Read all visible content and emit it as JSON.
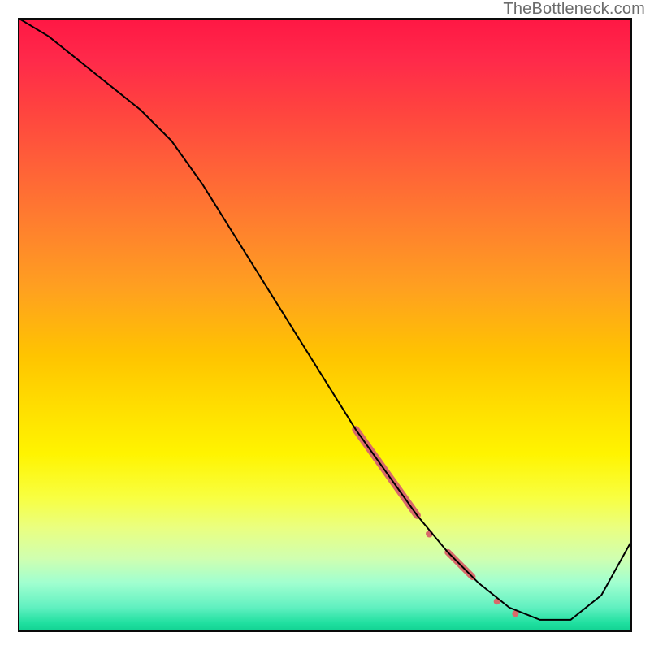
{
  "watermark": "TheBottleneck.com",
  "chart_data": {
    "type": "line",
    "title": "",
    "xlabel": "",
    "ylabel": "",
    "xlim": [
      0,
      100
    ],
    "ylim": [
      0,
      100
    ],
    "grid": false,
    "legend": false,
    "series": [
      {
        "name": "bottleneck-curve",
        "x": [
          0,
          5,
          10,
          15,
          20,
          25,
          30,
          35,
          40,
          45,
          50,
          55,
          60,
          65,
          70,
          75,
          80,
          85,
          90,
          95,
          100
        ],
        "y": [
          100,
          97,
          93,
          89,
          85,
          80,
          73,
          65,
          57,
          49,
          41,
          33,
          26,
          19,
          13,
          8,
          4,
          2,
          2,
          6,
          15
        ],
        "color": "#000000",
        "stroke_width": 2
      }
    ],
    "markers": [
      {
        "name": "highlight-segment-thick",
        "type": "line_segment",
        "x0": 55,
        "y0": 33,
        "x1": 65,
        "y1": 19,
        "color": "#d86a6a",
        "stroke_width": 9,
        "cap": "round"
      },
      {
        "name": "highlight-dot-upper",
        "type": "point",
        "x": 67,
        "y": 16,
        "color": "#d86a6a",
        "r": 4.5
      },
      {
        "name": "highlight-segment-mid",
        "type": "line_segment",
        "x0": 70,
        "y0": 13,
        "x1": 74,
        "y1": 9,
        "color": "#d86a6a",
        "stroke_width": 8,
        "cap": "round"
      },
      {
        "name": "highlight-dot-lower",
        "type": "point",
        "x": 78,
        "y": 5,
        "color": "#d86a6a",
        "r": 4
      },
      {
        "name": "highlight-dot-bottom",
        "type": "point",
        "x": 81,
        "y": 3,
        "color": "#d86a6a",
        "r": 4
      }
    ]
  }
}
